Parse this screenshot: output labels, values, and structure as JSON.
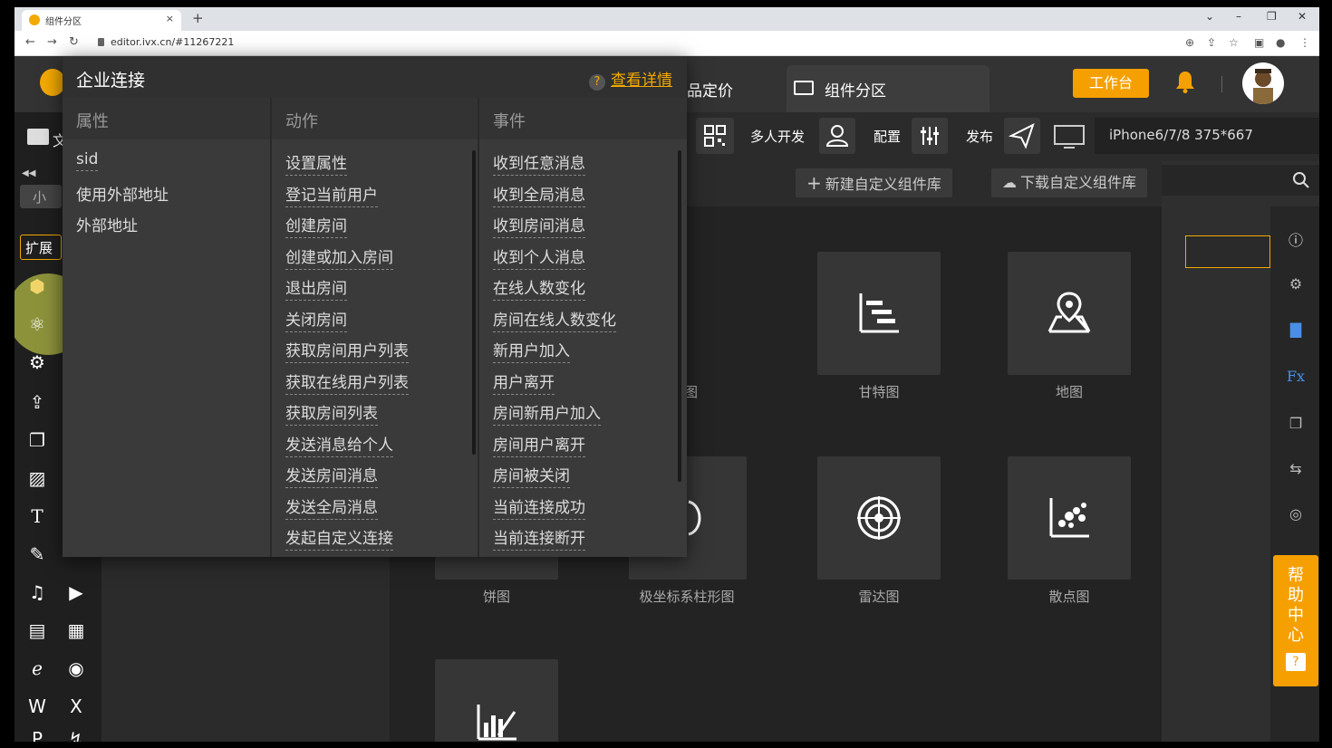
{
  "browser": {
    "tab_title": "组件分区",
    "tab_close": "×",
    "new_tab": "+",
    "url": "editor.ivx.cn/#11267221",
    "controls": {
      "minimize": "–",
      "restore": "❐",
      "close": "✕",
      "dropdown": "⌄"
    }
  },
  "header": {
    "partial_tab": "品定价",
    "component_tab": "组件分区",
    "workbench_button": "工作台"
  },
  "toolbar": {
    "multi_dev": "多人开发",
    "config": "配置",
    "publish": "发布",
    "device": "iPhone6/7/8 375*667"
  },
  "sidebar": {
    "file_label": "文",
    "mini_tag": "小",
    "ext_tag": "扩展"
  },
  "library": {
    "new_button": "新建自定义组件库",
    "download_button": "下载自定义组件库",
    "components": [
      {
        "label": "图"
      },
      {
        "label": "甘特图"
      },
      {
        "label": "地图"
      },
      {
        "label": "饼图"
      },
      {
        "label": "极坐标系柱形图"
      },
      {
        "label": "雷达图"
      },
      {
        "label": "散点图"
      }
    ]
  },
  "help_center": {
    "line1": "帮",
    "line2": "助",
    "line3": "中",
    "line4": "心",
    "icon": "?"
  },
  "popup": {
    "title": "企业连接",
    "help_link": "查看详情",
    "help_icon": "?",
    "columns": {
      "properties": {
        "header": "属性",
        "items": [
          "sid",
          "使用外部地址",
          "外部地址"
        ]
      },
      "actions": {
        "header": "动作",
        "items": [
          "设置属性",
          "登记当前用户",
          "创建房间",
          "创建或加入房间",
          "退出房间",
          "关闭房间",
          "获取房间用户列表",
          "获取在线用户列表",
          "获取房间列表",
          "发送消息给个人",
          "发送房间消息",
          "发送全局消息",
          "发起自定义连接"
        ]
      },
      "events": {
        "header": "事件",
        "items": [
          "收到任意消息",
          "收到全局消息",
          "收到房间消息",
          "收到个人消息",
          "在线人数变化",
          "房间在线人数变化",
          "新用户加入",
          "用户离开",
          "房间新用户加入",
          "房间用户离开",
          "房间被关闭",
          "当前连接成功",
          "当前连接断开"
        ]
      }
    }
  },
  "colors": {
    "accent": "#f5a000",
    "bg": "#2b2b2b",
    "popup": "#3a3a3a"
  }
}
